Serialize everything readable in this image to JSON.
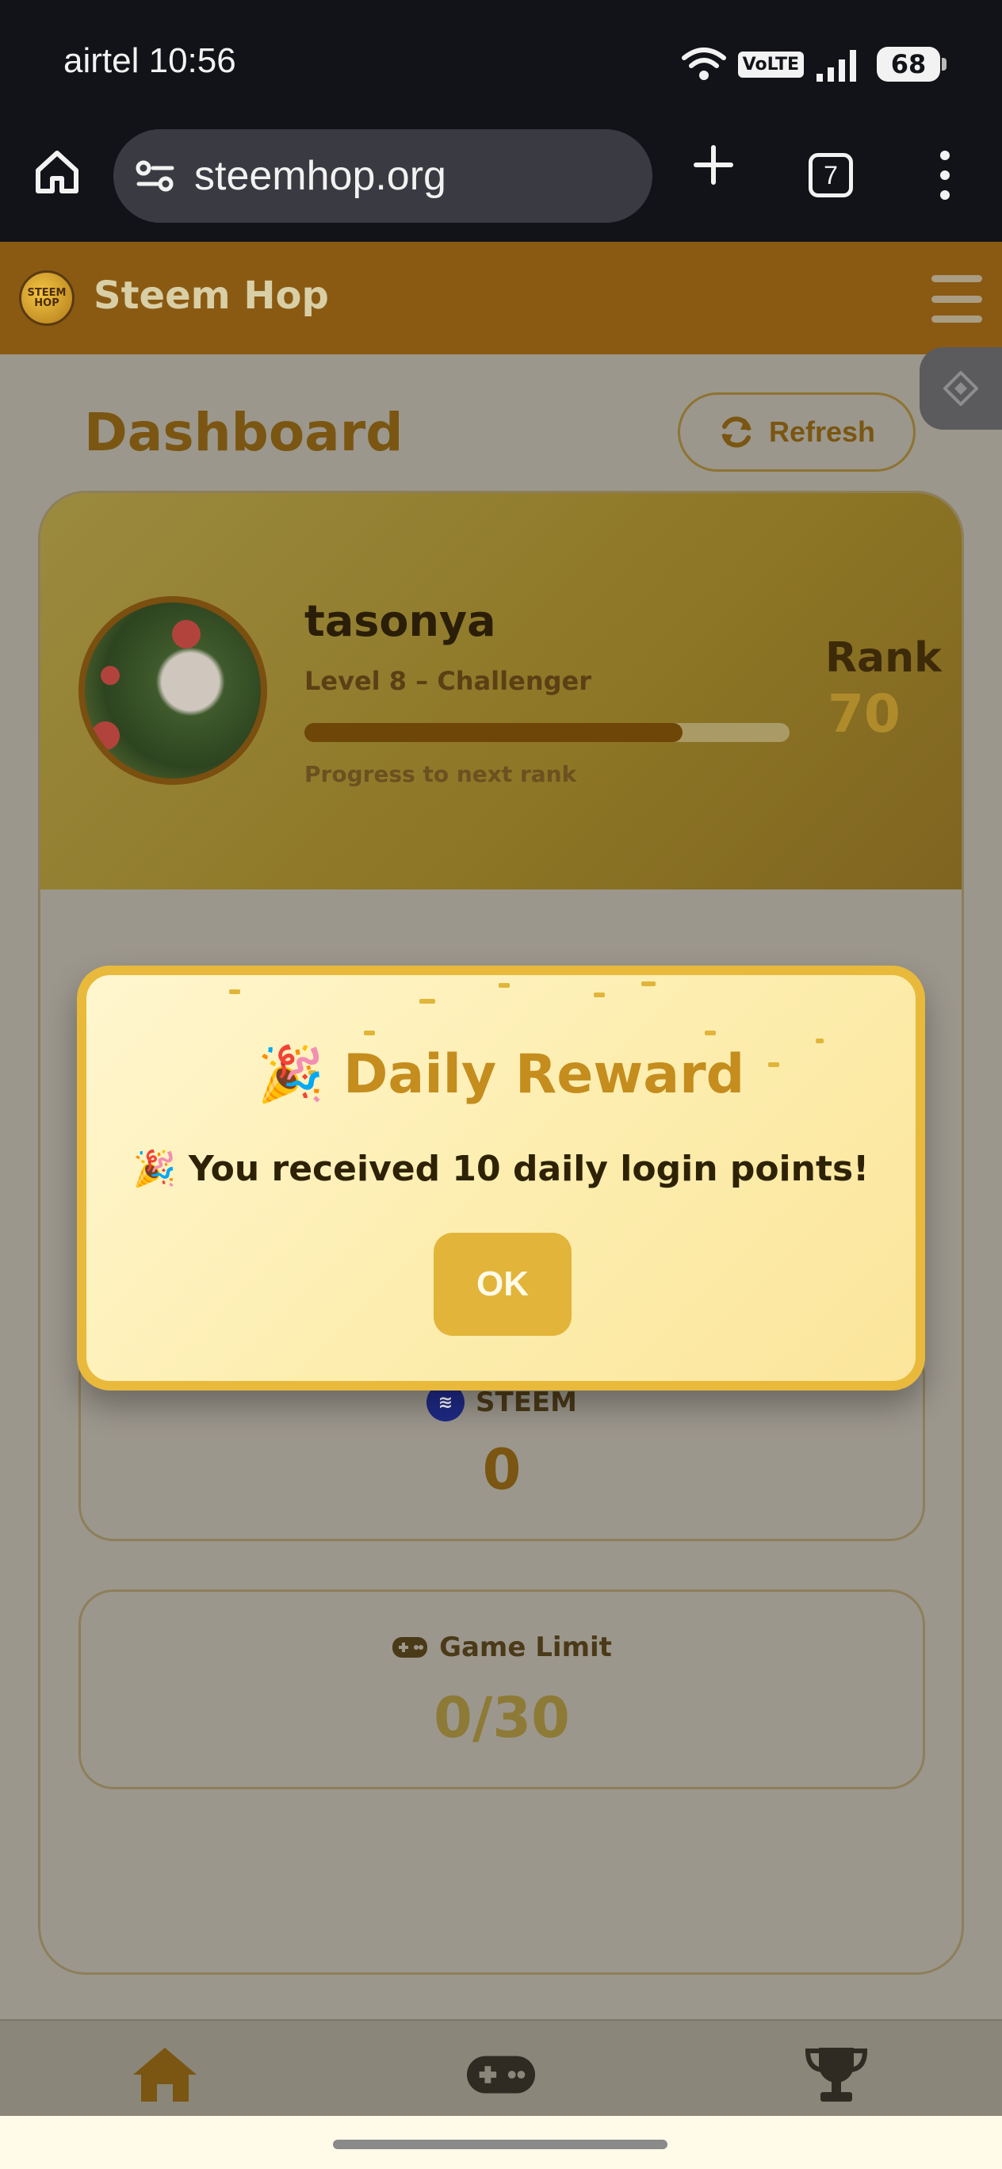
{
  "status_bar": {
    "carrier_time": "airtel 10:56",
    "volte": "VoLTE",
    "battery": "68"
  },
  "browser": {
    "url": "steemhop.org",
    "tab_count": "7",
    "icons": [
      "home-icon",
      "site-settings-icon",
      "new-tab-icon",
      "tabs-icon",
      "more-vert-icon"
    ]
  },
  "app": {
    "title": "Steem Hop",
    "logo_text": "STEEM HOP"
  },
  "dashboard": {
    "title": "Dashboard",
    "refresh_label": "Refresh"
  },
  "profile": {
    "username": "tasonya",
    "level": "Level 8 – Challenger",
    "progress_fraction": 0.78,
    "progress_label": "Progress to next rank",
    "rank_label": "Rank",
    "rank_value": "70"
  },
  "stats": {
    "steem_label": "STEEM",
    "steem_value": "0",
    "game_limit_label": "Game Limit",
    "game_limit_value": "0/30"
  },
  "modal": {
    "title": "🎉 Daily Reward",
    "message": "🎉 You received 10 daily login points!",
    "ok_label": "OK"
  },
  "colors": {
    "accent": "#e2b43a",
    "header": "#8a5a13",
    "brand_brown": "#7a5612"
  }
}
